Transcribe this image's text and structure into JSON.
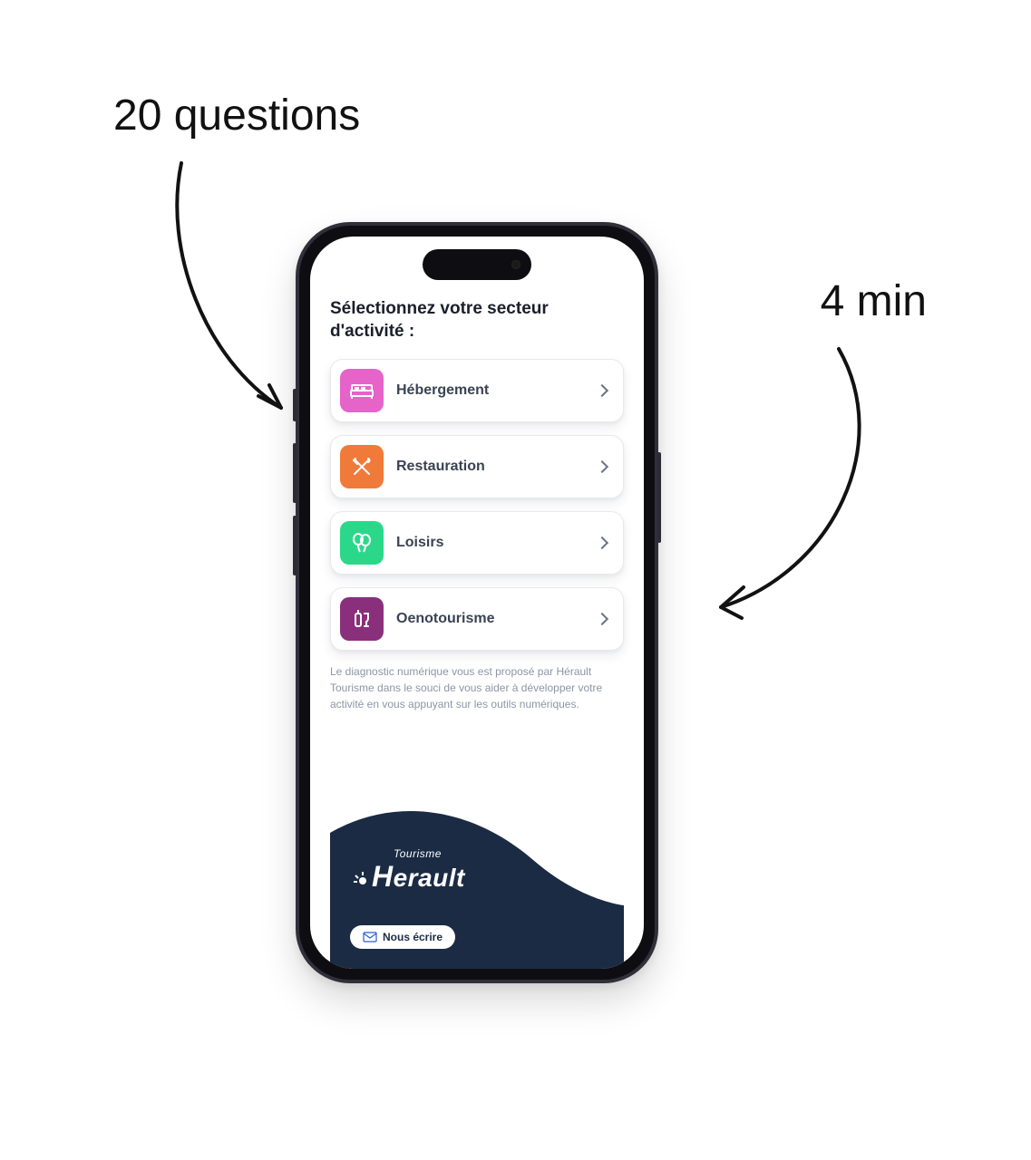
{
  "callouts": {
    "questions": "20 questions",
    "duration": "4 min"
  },
  "app": {
    "heading": "Sélectionnez votre secteur d'activité :",
    "sectors": [
      {
        "icon": "bed-icon",
        "label": "Hébergement",
        "color": "pink"
      },
      {
        "icon": "utensils-icon",
        "label": "Restauration",
        "color": "orange"
      },
      {
        "icon": "balloons-icon",
        "label": "Loisirs",
        "color": "green"
      },
      {
        "icon": "wine-icon",
        "label": "Oenotourisme",
        "color": "purple"
      }
    ],
    "description": "Le diagnostic numérique vous est proposé par Hérault Tourisme dans le souci de vous aider à développer votre activité en vous appuyant sur les outils numériques.",
    "logo": {
      "sub": "Tourisme",
      "main": "erault"
    },
    "contact_label": "Nous écrire"
  },
  "colors": {
    "pink": "#e663c9",
    "orange": "#f07a3a",
    "green": "#2bd889",
    "purple": "#8a2f7b",
    "navy": "#1b2b44"
  }
}
